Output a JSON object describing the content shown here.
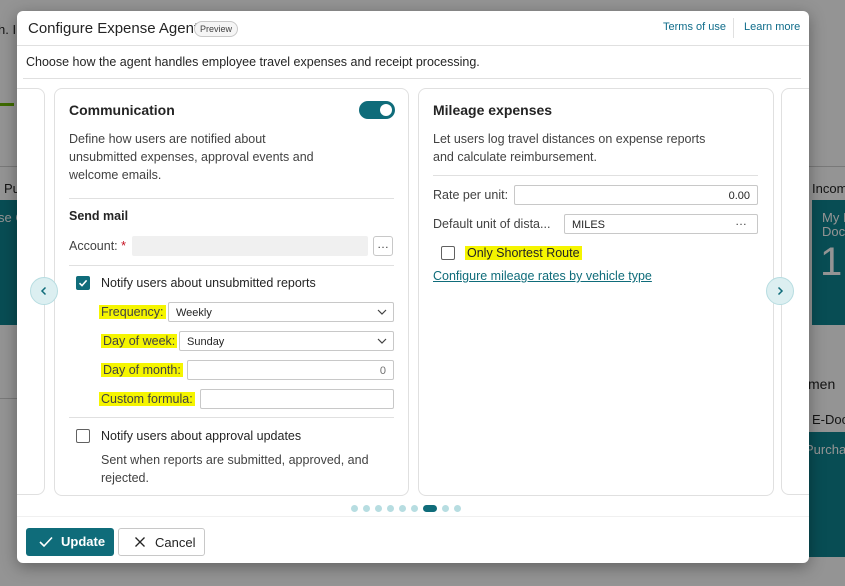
{
  "background": {
    "fragments": [
      "h. I",
      "Pu",
      "se C",
      "Incom",
      "My I",
      "Doc",
      "1",
      "men",
      "E-Doc",
      "Purchas"
    ]
  },
  "dialog": {
    "title": "Configure Expense Agent",
    "badge": "Preview",
    "terms_link": "Terms of use",
    "learn_link": "Learn more",
    "description": "Choose how the agent handles employee travel expenses and receipt processing."
  },
  "communication": {
    "title": "Communication",
    "toggle_on": true,
    "description_lines": [
      "Define how users are notified about",
      "unsubmitted expenses, approval events and",
      "welcome emails."
    ],
    "send_mail_heading": "Send mail",
    "account_label": "Account:",
    "account_required": "*",
    "account_value": "",
    "more_button": "…",
    "unsubmitted_label": "Notify users about unsubmitted reports",
    "unsubmitted_checked": true,
    "frequency_label": "Frequency:",
    "frequency_value": "Weekly",
    "day_of_week_label": "Day of week:",
    "day_of_week_value": "Sunday",
    "day_of_month_label": "Day of month:",
    "day_of_month_value": "0",
    "custom_formula_label": "Custom formula:",
    "custom_formula_value": "",
    "approval_label": "Notify users about approval updates",
    "approval_checked": false,
    "approval_description_lines": [
      "Sent when reports are submitted, approved, and",
      "rejected."
    ]
  },
  "mileage": {
    "title": "Mileage expenses",
    "description_lines": [
      "Let users log travel distances on expense reports",
      "and calculate reimbursement."
    ],
    "rate_label": "Rate per unit:",
    "rate_value": "0.00",
    "unit_label": "Default unit of dista...",
    "unit_value": "MILES",
    "more_button": "…",
    "shortest_route_label": "Only Shortest Route",
    "shortest_route_checked": false,
    "configure_link": "Configure mileage rates by vehicle type"
  },
  "carousel": {
    "page_count": 9,
    "active_index": 6
  },
  "footer": {
    "update_label": "Update",
    "cancel_label": "Cancel"
  },
  "colors": {
    "accent": "#0f6c7a",
    "highlight": "#f5f500",
    "required": "#c50f1f"
  }
}
